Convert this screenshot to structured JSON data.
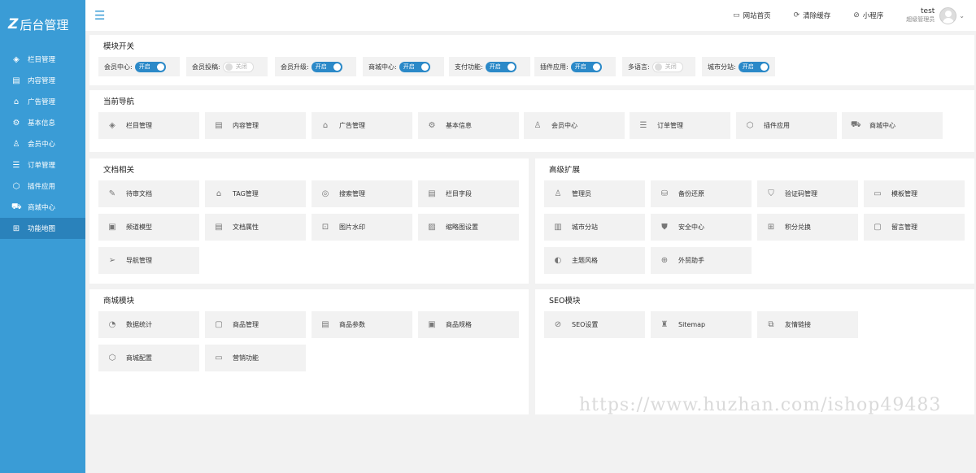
{
  "brand": {
    "mark": "Z",
    "title": "后台管理"
  },
  "sidebar": {
    "items": [
      {
        "icon": "layers-icon",
        "glyph": "◈",
        "label": "栏目管理"
      },
      {
        "icon": "document-icon",
        "glyph": "▤",
        "label": "内容管理"
      },
      {
        "icon": "ad-icon",
        "glyph": "⌂",
        "label": "广告管理"
      },
      {
        "icon": "gear-icon",
        "glyph": "⚙",
        "label": "基本信息"
      },
      {
        "icon": "user-icon",
        "glyph": "♙",
        "label": "会员中心"
      },
      {
        "icon": "order-icon",
        "glyph": "☰",
        "label": "订单管理"
      },
      {
        "icon": "cube-icon",
        "glyph": "⬡",
        "label": "插件应用"
      },
      {
        "icon": "cart-icon",
        "glyph": "⛟",
        "label": "商城中心"
      },
      {
        "icon": "grid-icon",
        "glyph": "⊞",
        "label": "功能地图"
      }
    ]
  },
  "topbar": {
    "links": [
      {
        "icon": "monitor-icon",
        "glyph": "▭",
        "label": "网站首页"
      },
      {
        "icon": "refresh-icon",
        "glyph": "⟳",
        "label": "清除缓存"
      },
      {
        "icon": "compass-icon",
        "glyph": "⊘",
        "label": "小程序"
      }
    ],
    "user": {
      "name": "test",
      "role": "超级管理员"
    }
  },
  "modules": {
    "title": "模块开关",
    "items": [
      {
        "label": "会员中心:",
        "state": "开启"
      },
      {
        "label": "会员投稿:",
        "state": "关闭"
      },
      {
        "label": "会员升级:",
        "state": "开启"
      },
      {
        "label": "商城中心:",
        "state": "开启"
      },
      {
        "label": "支付功能:",
        "state": "开启"
      },
      {
        "label": "插件应用:",
        "state": "开启"
      },
      {
        "label": "多语言:",
        "state": "关闭"
      },
      {
        "label": "城市分站:",
        "state": "开启"
      }
    ]
  },
  "current_nav": {
    "title": "当前导航",
    "items": [
      {
        "icon": "layers-icon",
        "glyph": "◈",
        "label": "栏目管理"
      },
      {
        "icon": "document-icon",
        "glyph": "▤",
        "label": "内容管理"
      },
      {
        "icon": "ad-icon",
        "glyph": "⌂",
        "label": "广告管理"
      },
      {
        "icon": "gear-icon",
        "glyph": "⚙",
        "label": "基本信息"
      },
      {
        "icon": "user-icon",
        "glyph": "♙",
        "label": "会员中心"
      },
      {
        "icon": "order-icon",
        "glyph": "☰",
        "label": "订单管理"
      },
      {
        "icon": "cube-icon",
        "glyph": "⬡",
        "label": "插件应用"
      },
      {
        "icon": "cart-icon",
        "glyph": "⛟",
        "label": "商城中心"
      }
    ]
  },
  "docs": {
    "title": "文档相关",
    "items": [
      {
        "icon": "edit-icon",
        "glyph": "✎",
        "label": "待审文档"
      },
      {
        "icon": "tag-icon",
        "glyph": "⌂",
        "label": "TAG管理"
      },
      {
        "icon": "search-icon",
        "glyph": "◎",
        "label": "搜索管理"
      },
      {
        "icon": "field-icon",
        "glyph": "▤",
        "label": "栏目字段"
      },
      {
        "icon": "tv-icon",
        "glyph": "▣",
        "label": "频道模型"
      },
      {
        "icon": "attribute-icon",
        "glyph": "▤",
        "label": "文档属性"
      },
      {
        "icon": "watermark-icon",
        "glyph": "⊡",
        "label": "图片水印"
      },
      {
        "icon": "image-icon",
        "glyph": "▨",
        "label": "缩略图设置"
      },
      {
        "icon": "send-icon",
        "glyph": "➢",
        "label": "导航管理"
      }
    ]
  },
  "advanced": {
    "title": "高级扩展",
    "items": [
      {
        "icon": "admin-icon",
        "glyph": "♙",
        "label": "管理员"
      },
      {
        "icon": "backup-icon",
        "glyph": "⛁",
        "label": "备份还原"
      },
      {
        "icon": "shield-icon",
        "glyph": "⛉",
        "label": "验证码管理"
      },
      {
        "icon": "template-icon",
        "glyph": "▭",
        "label": "模板管理"
      },
      {
        "icon": "building-icon",
        "glyph": "▥",
        "label": "城市分站"
      },
      {
        "icon": "security-icon",
        "glyph": "⛊",
        "label": "安全中心"
      },
      {
        "icon": "gift-icon",
        "glyph": "⊞",
        "label": "积分兑换"
      },
      {
        "icon": "message-icon",
        "glyph": "▢",
        "label": "留言管理"
      },
      {
        "icon": "palette-icon",
        "glyph": "◐",
        "label": "主题风格"
      },
      {
        "icon": "globe-icon",
        "glyph": "⊕",
        "label": "外贸助手"
      }
    ]
  },
  "shop": {
    "title": "商城模块",
    "items": [
      {
        "icon": "chart-icon",
        "glyph": "◔",
        "label": "数据统计"
      },
      {
        "icon": "goods-icon",
        "glyph": "▢",
        "label": "商品管理"
      },
      {
        "icon": "params-icon",
        "glyph": "▤",
        "label": "商品参数"
      },
      {
        "icon": "spec-icon",
        "glyph": "▣",
        "label": "商品规格"
      },
      {
        "icon": "config-icon",
        "glyph": "⬡",
        "label": "商城配置"
      },
      {
        "icon": "marketing-icon",
        "glyph": "▭",
        "label": "营销功能"
      }
    ]
  },
  "seo": {
    "title": "SEO模块",
    "items": [
      {
        "icon": "seo-icon",
        "glyph": "⊘",
        "label": "SEO设置"
      },
      {
        "icon": "sitemap-icon",
        "glyph": "♜",
        "label": "Sitemap"
      },
      {
        "icon": "link-icon",
        "glyph": "⧉",
        "label": "友情链接"
      }
    ]
  },
  "watermark": "https://www.huzhan.com/ishop49483"
}
